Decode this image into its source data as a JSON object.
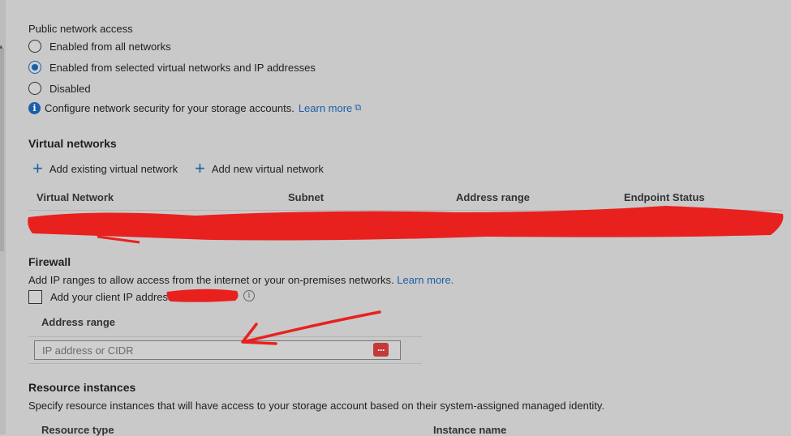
{
  "network_access": {
    "label": "Public network access",
    "options": [
      {
        "label": "Enabled from all networks",
        "selected": false
      },
      {
        "label": "Enabled from selected virtual networks and IP addresses",
        "selected": true
      },
      {
        "label": "Disabled",
        "selected": false
      }
    ],
    "info_text": "Configure network security for your storage accounts.",
    "info_link": "Learn more"
  },
  "virtual_networks": {
    "title": "Virtual networks",
    "add_existing": "Add existing virtual network",
    "add_new": "Add new virtual network",
    "columns": [
      "Virtual Network",
      "Subnet",
      "Address range",
      "Endpoint Status"
    ]
  },
  "firewall": {
    "title": "Firewall",
    "description": "Add IP ranges to allow access from the internet or your on-premises networks.",
    "learn_more": "Learn more.",
    "client_ip_label": "Add your client IP address",
    "address_range_header": "Address range",
    "ip_placeholder": "IP address or CIDR",
    "ellipsis": "···"
  },
  "resource_instances": {
    "title": "Resource instances",
    "description": "Specify resource instances that will have access to your storage account based on their system-assigned managed identity.",
    "columns": [
      "Resource type",
      "Instance name"
    ]
  },
  "colors": {
    "accent": "#1a5fa8",
    "redaction": "#e8211f",
    "background": "#c9c9c9"
  }
}
